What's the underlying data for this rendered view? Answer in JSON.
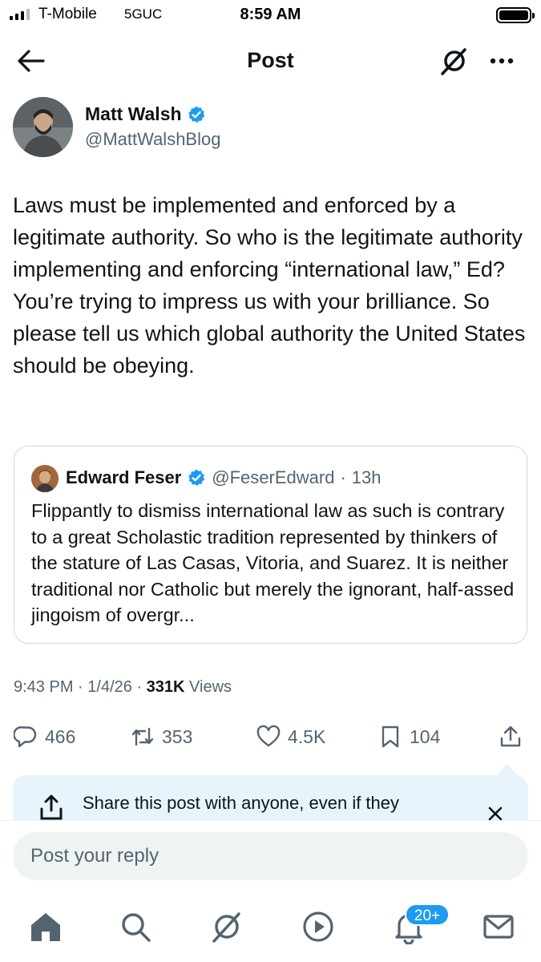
{
  "status_bar": {
    "carrier": "T-Mobile",
    "network": "5GUC",
    "time": "8:59 AM"
  },
  "header": {
    "title": "Post",
    "icons": [
      "back-arrow-icon",
      "grok-icon",
      "more-icon"
    ]
  },
  "post": {
    "author_name": "Matt Walsh",
    "author_handle": "@MattWalshBlog",
    "verified": true,
    "text": "Laws must be implemented and enforced by a legitimate authority. So who is the legitimate authority implementing and enforcing “international law,” Ed? You’re trying to impress us with your brilliance. So please tell us which global authority the United States should be obeying.",
    "timestamp": "9:43 PM",
    "date": "1/4/26",
    "views_count": "331K",
    "views_label": "Views"
  },
  "quote": {
    "author_name": "Edward Feser",
    "author_handle": "@FeserEdward",
    "separator": "·",
    "time": "13h",
    "verified": true,
    "text": "Flippantly to dismiss international law as such is contrary to a great Scholastic tradition represented by thinkers of the stature of Las Casas, Vitoria, and Suarez. It is neither traditional nor Catholic but merely the ignorant, half-assed jingoism of overgr..."
  },
  "actions": {
    "replies": "466",
    "reposts": "353",
    "likes": "4.5K",
    "bookmarks": "104"
  },
  "share_banner": {
    "text": "Share this post with anyone, even if they"
  },
  "reply": {
    "placeholder": "Post your reply"
  },
  "bottom_nav": {
    "items": [
      "home-icon",
      "search-icon",
      "grok-icon",
      "video-icon",
      "notifications-icon",
      "messages-icon"
    ],
    "notifications_badge": "20+"
  },
  "colors": {
    "accent": "#1d9bf0",
    "secondary_text": "#536471",
    "banner_bg": "#e8f4fb"
  }
}
